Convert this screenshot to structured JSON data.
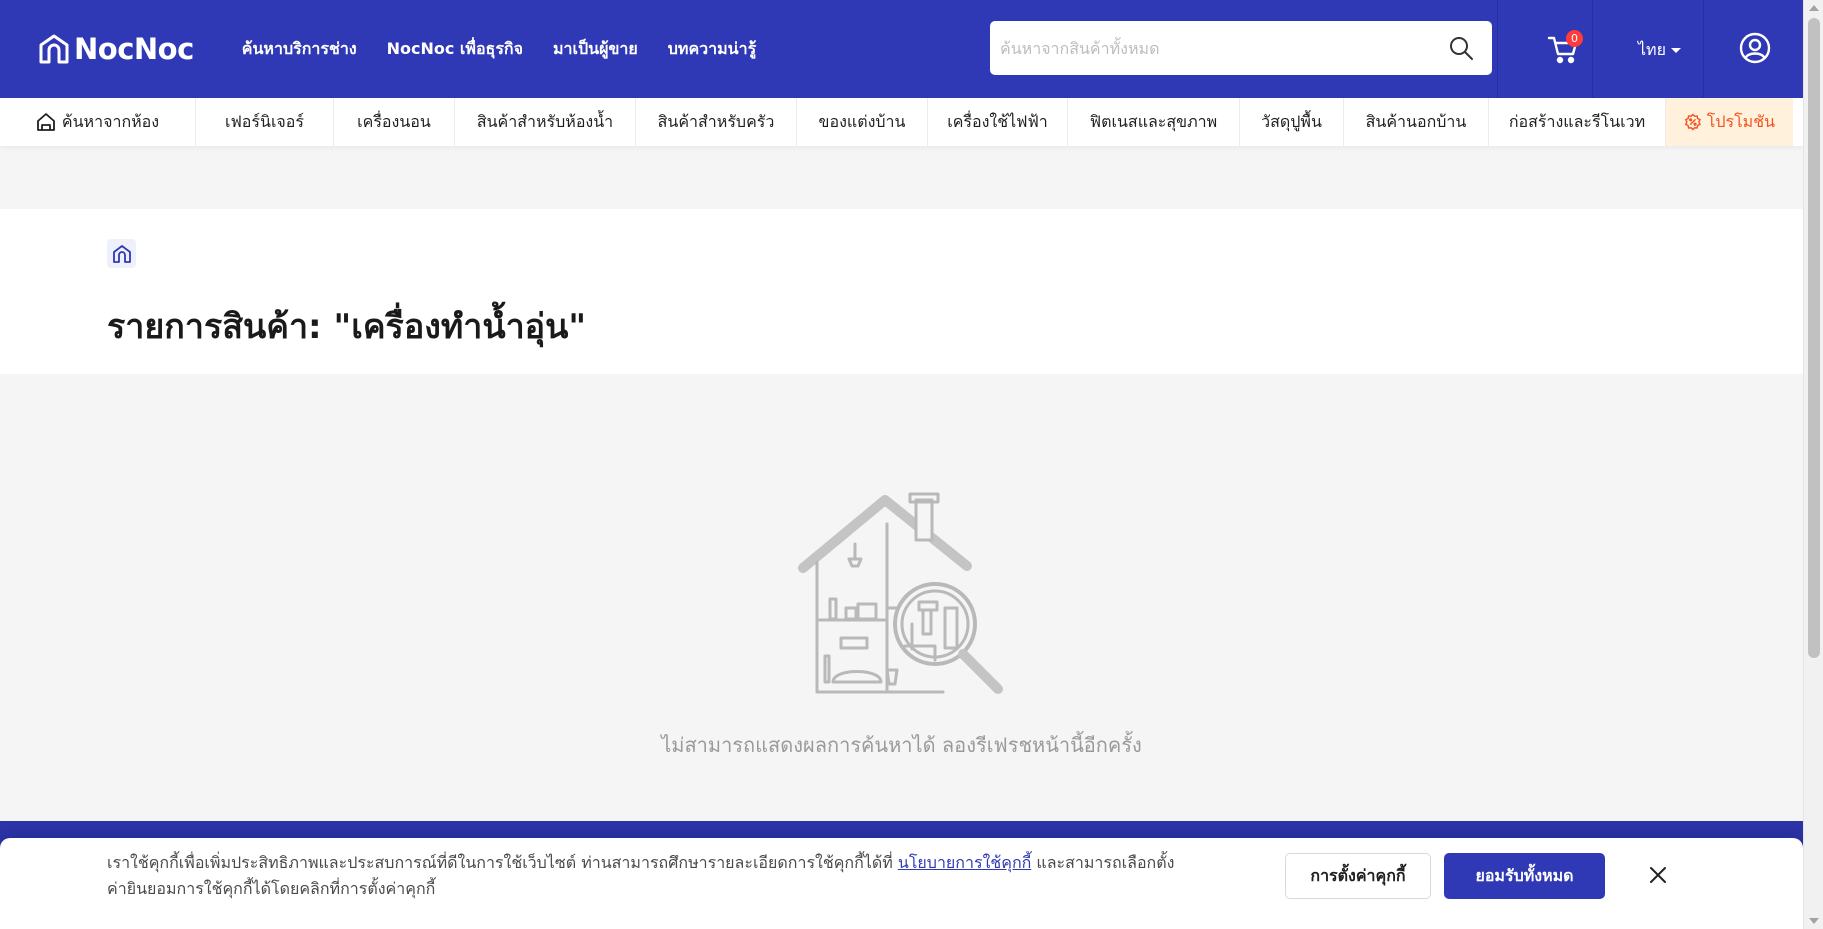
{
  "header": {
    "brand": "NocNoc",
    "nav": [
      {
        "label": "ค้นหาบริการช่าง"
      },
      {
        "label": "NocNoc เพื่อธุรกิจ"
      },
      {
        "label": "มาเป็นผู้ขาย"
      },
      {
        "label": "บทความน่ารู้"
      }
    ],
    "search": {
      "placeholder": "ค้นหาจากสินค้าทั้งหมด",
      "value": ""
    },
    "cart_count": "0",
    "language": "ไทย"
  },
  "categories": [
    {
      "label": "ค้นหาจากห้อง",
      "icon": "home-room-icon"
    },
    {
      "label": "เฟอร์นิเจอร์"
    },
    {
      "label": "เครื่องนอน"
    },
    {
      "label": "สินค้าสำหรับห้องน้ำ"
    },
    {
      "label": "สินค้าสำหรับครัว"
    },
    {
      "label": "ของแต่งบ้าน"
    },
    {
      "label": "เครื่องใช้ไฟฟ้า"
    },
    {
      "label": "ฟิตเนสและสุขภาพ"
    },
    {
      "label": "วัสดุปูพื้น"
    },
    {
      "label": "สินค้านอกบ้าน"
    },
    {
      "label": "ก่อสร้างและรีโนเวท"
    },
    {
      "label": "โปรโมชัน",
      "icon": "promotion-icon"
    }
  ],
  "page": {
    "title": "รายการสินค้า: \"เครื่องทำน้ำอุ่น\""
  },
  "empty_state": {
    "message": "ไม่สามารถแสดงผลการค้นหาได้ ลองรีเฟรชหน้านี้อีกครั้ง"
  },
  "cookie_banner": {
    "text_before": "เราใช้คุกกี้เพื่อเพิ่มประสิทธิภาพและประสบการณ์ที่ดีในการใช้เว็บไซต์ ท่านสามารถศึกษารายละเอียดการใช้คุกกี้ได้ที่ ",
    "policy_link": "นโยบายการใช้คุกกี้",
    "text_after": " และสามารถเลือกตั้งค่ายินยอมการใช้คุกกี้ได้โดยคลิกที่การตั้งค่าคุกกี้",
    "settings_button": "การตั้งค่าคุกกี้",
    "accept_button": "ยอมรับทั้งหมด"
  },
  "colors": {
    "brand_primary": "#3039b5",
    "promo_background": "#fff1dc",
    "promo_text": "#f4511e",
    "badge": "#ff3b3b"
  }
}
